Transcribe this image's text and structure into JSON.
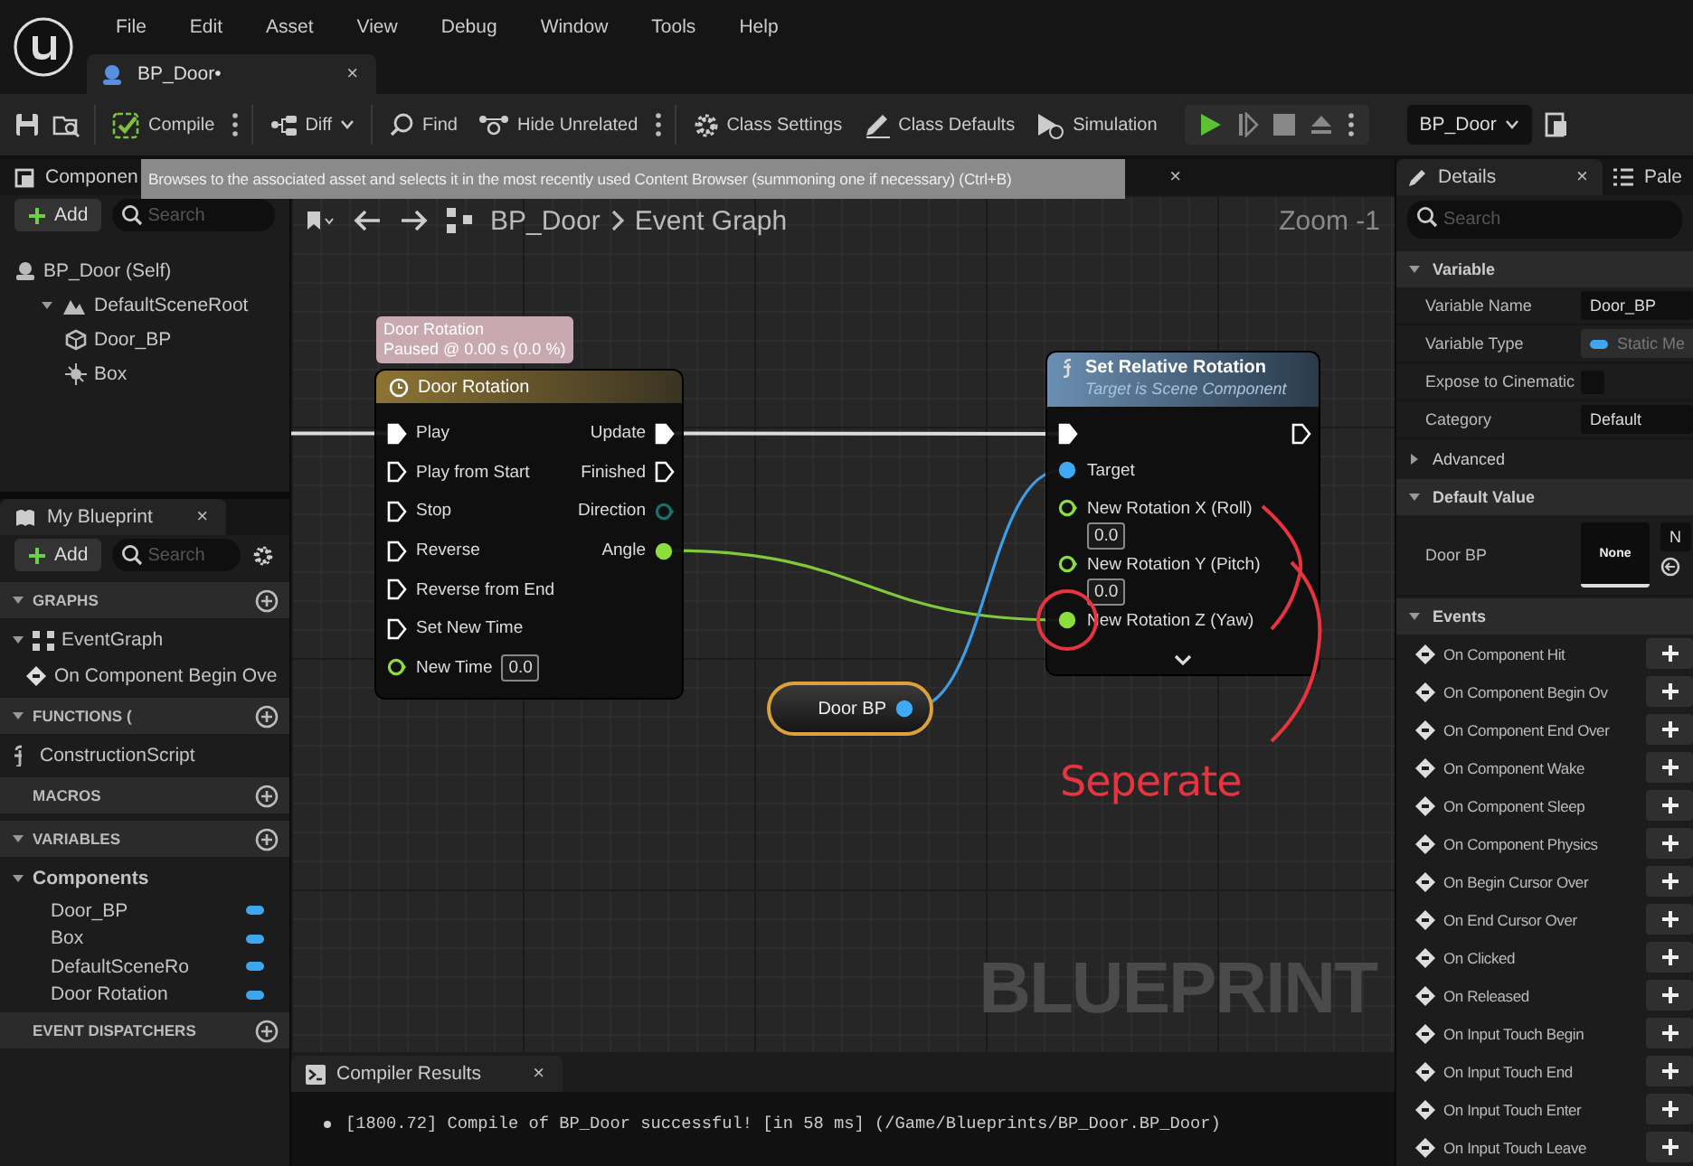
{
  "menu_bar": {
    "menus": [
      "File",
      "Edit",
      "Asset",
      "View",
      "Debug",
      "Window",
      "Tools",
      "Help"
    ]
  },
  "document_tab": {
    "label": "BP_Door•",
    "close": "×"
  },
  "toolbar": {
    "buttons": [
      {
        "label": "Compile",
        "more": true
      },
      {
        "label": "Diff",
        "dropdown": true
      },
      {
        "label": "Find"
      },
      {
        "label": "Hide Unrelated",
        "more": true
      },
      {
        "label": "Class Settings"
      },
      {
        "label": "Class Defaults"
      },
      {
        "label": "Simulation"
      }
    ],
    "asset_dropdown": "BP_Door"
  },
  "tooltip": "Browses to the associated asset and selects it in the most recently used Content Browser (summoning one if necessary) (Ctrl+B)",
  "components_panel": {
    "title": "Componen",
    "add": "Add",
    "search_placeholder": "Search",
    "tree": [
      {
        "label": "BP_Door (Self)",
        "kind": "self",
        "children": [
          {
            "label": "DefaultSceneRoot",
            "kind": "scene",
            "expanded": true,
            "children": [
              {
                "label": "Door_BP",
                "kind": "mesh"
              },
              {
                "label": "Box",
                "kind": "collision"
              }
            ]
          }
        ]
      }
    ]
  },
  "my_blueprint": {
    "title": "My Blueprint",
    "close": "×",
    "add": "Add",
    "search_placeholder": "Search",
    "sections": [
      {
        "title": "GRAPHS",
        "expanded": true,
        "items": [
          {
            "label": "EventGraph",
            "kind": "graph",
            "expanded": true,
            "children": [
              {
                "label": "On Component Begin Ove",
                "kind": "event"
              }
            ]
          }
        ]
      },
      {
        "title": "FUNCTIONS (",
        "expanded": true,
        "items": [
          {
            "label": "ConstructionScript",
            "kind": "function"
          }
        ]
      },
      {
        "title": "MACROS"
      },
      {
        "title": "VARIABLES",
        "expanded": true,
        "items": [
          {
            "label": "Components",
            "kind": "category",
            "expanded": true,
            "children": [
              {
                "label": "Door_BP",
                "kind": "variable"
              },
              {
                "label": "Box",
                "kind": "variable"
              },
              {
                "label": "DefaultSceneRo",
                "kind": "variable"
              },
              {
                "label": "Door Rotation",
                "kind": "variable"
              }
            ]
          }
        ]
      },
      {
        "title": "EVENT DISPATCHERS"
      }
    ]
  },
  "graph_tab_bar": {
    "close": "×"
  },
  "graph": {
    "breadcrumb": [
      "BP_Door",
      "Event Graph"
    ],
    "zoom": "Zoom -1",
    "watermark": "BLUEPRINT",
    "nodes": [
      {
        "kind": "timeline",
        "title": "Door Rotation",
        "comment": [
          "Door Rotation",
          "Paused @ 0.00 s (0.0 %)"
        ],
        "inputs": [
          {
            "label": "Play",
            "kind": "exec",
            "connected": true
          },
          {
            "label": "Play from Start",
            "kind": "exec",
            "connected": false
          },
          {
            "label": "Stop",
            "kind": "exec",
            "connected": false
          },
          {
            "label": "Reverse",
            "kind": "exec",
            "connected": false
          },
          {
            "label": "Reverse from End",
            "kind": "exec",
            "connected": false
          },
          {
            "label": "Set New Time",
            "kind": "exec",
            "connected": false
          },
          {
            "label": "New Time",
            "kind": "float",
            "connected": false,
            "value": "0.0"
          }
        ],
        "outputs": [
          {
            "label": "Update",
            "kind": "exec",
            "connected": true
          },
          {
            "label": "Finished",
            "kind": "exec",
            "connected": false
          },
          {
            "label": "Direction",
            "kind": "enum",
            "connected": false
          },
          {
            "label": "Angle",
            "kind": "float",
            "connected": true
          }
        ]
      },
      {
        "kind": "function",
        "title": "Set Relative Rotation",
        "subtitle": "Target is Scene Component",
        "inputs": [
          {
            "kind": "exec",
            "connected": true
          },
          {
            "label": "Target",
            "kind": "object",
            "connected": true
          },
          {
            "label": "New Rotation X (Roll)",
            "kind": "float",
            "connected": false,
            "value": "0.0"
          },
          {
            "label": "New Rotation Y (Pitch)",
            "kind": "float",
            "connected": false,
            "value": "0.0"
          },
          {
            "label": "New Rotation Z (Yaw)",
            "kind": "float",
            "connected": true
          }
        ],
        "outputs": [
          {
            "kind": "exec",
            "connected": false
          }
        ]
      },
      {
        "kind": "variable",
        "title": "Door BP",
        "outputs": [
          {
            "kind": "object",
            "connected": true
          }
        ]
      }
    ]
  },
  "annotation": {
    "text": "Seperate"
  },
  "compiler_results": {
    "title": "Compiler Results",
    "close": "×",
    "messages": [
      "[1800.72] Compile of BP_Door successful! [in 58 ms] (/Game/Blueprints/BP_Door.BP_Door)"
    ]
  },
  "details": {
    "tabs": [
      {
        "label": "Details",
        "selected": true,
        "close": "×"
      },
      {
        "label": "Pale",
        "selected": false
      }
    ],
    "search_placeholder": "Search",
    "sections": [
      {
        "kind": "header",
        "title": "Variable",
        "expanded": true,
        "rows": [
          {
            "kind": "text",
            "label": "Variable Name",
            "value": "Door_BP"
          },
          {
            "kind": "type",
            "label": "Variable Type",
            "value": "Static Me"
          },
          {
            "kind": "checkbox",
            "label": "Expose to Cinematic",
            "checked": false
          },
          {
            "kind": "dropdown",
            "label": "Category",
            "value": "Default"
          }
        ]
      },
      {
        "kind": "subsection",
        "title": "Advanced",
        "expanded": false
      },
      {
        "kind": "header",
        "title": "Default Value",
        "expanded": true,
        "rows": [
          {
            "kind": "asset",
            "label": "Door BP",
            "thumbnail": "None",
            "value": "N"
          }
        ]
      },
      {
        "kind": "header",
        "title": "Events",
        "expanded": true,
        "rows": [
          {
            "kind": "event",
            "label": "On Component Hit"
          },
          {
            "kind": "event",
            "label": "On Component Begin Ov"
          },
          {
            "kind": "event",
            "label": "On Component End Over"
          },
          {
            "kind": "event",
            "label": "On Component Wake"
          },
          {
            "kind": "event",
            "label": "On Component Sleep"
          },
          {
            "kind": "event",
            "label": "On Component Physics"
          },
          {
            "kind": "event",
            "label": "On Begin Cursor Over"
          },
          {
            "kind": "event",
            "label": "On End Cursor Over"
          },
          {
            "kind": "event",
            "label": "On Clicked"
          },
          {
            "kind": "event",
            "label": "On Released"
          },
          {
            "kind": "event",
            "label": "On Input Touch Begin"
          },
          {
            "kind": "event",
            "label": "On Input Touch End"
          },
          {
            "kind": "event",
            "label": "On Input Touch Enter"
          },
          {
            "kind": "event",
            "label": "On Input Touch Leave"
          }
        ]
      }
    ]
  }
}
